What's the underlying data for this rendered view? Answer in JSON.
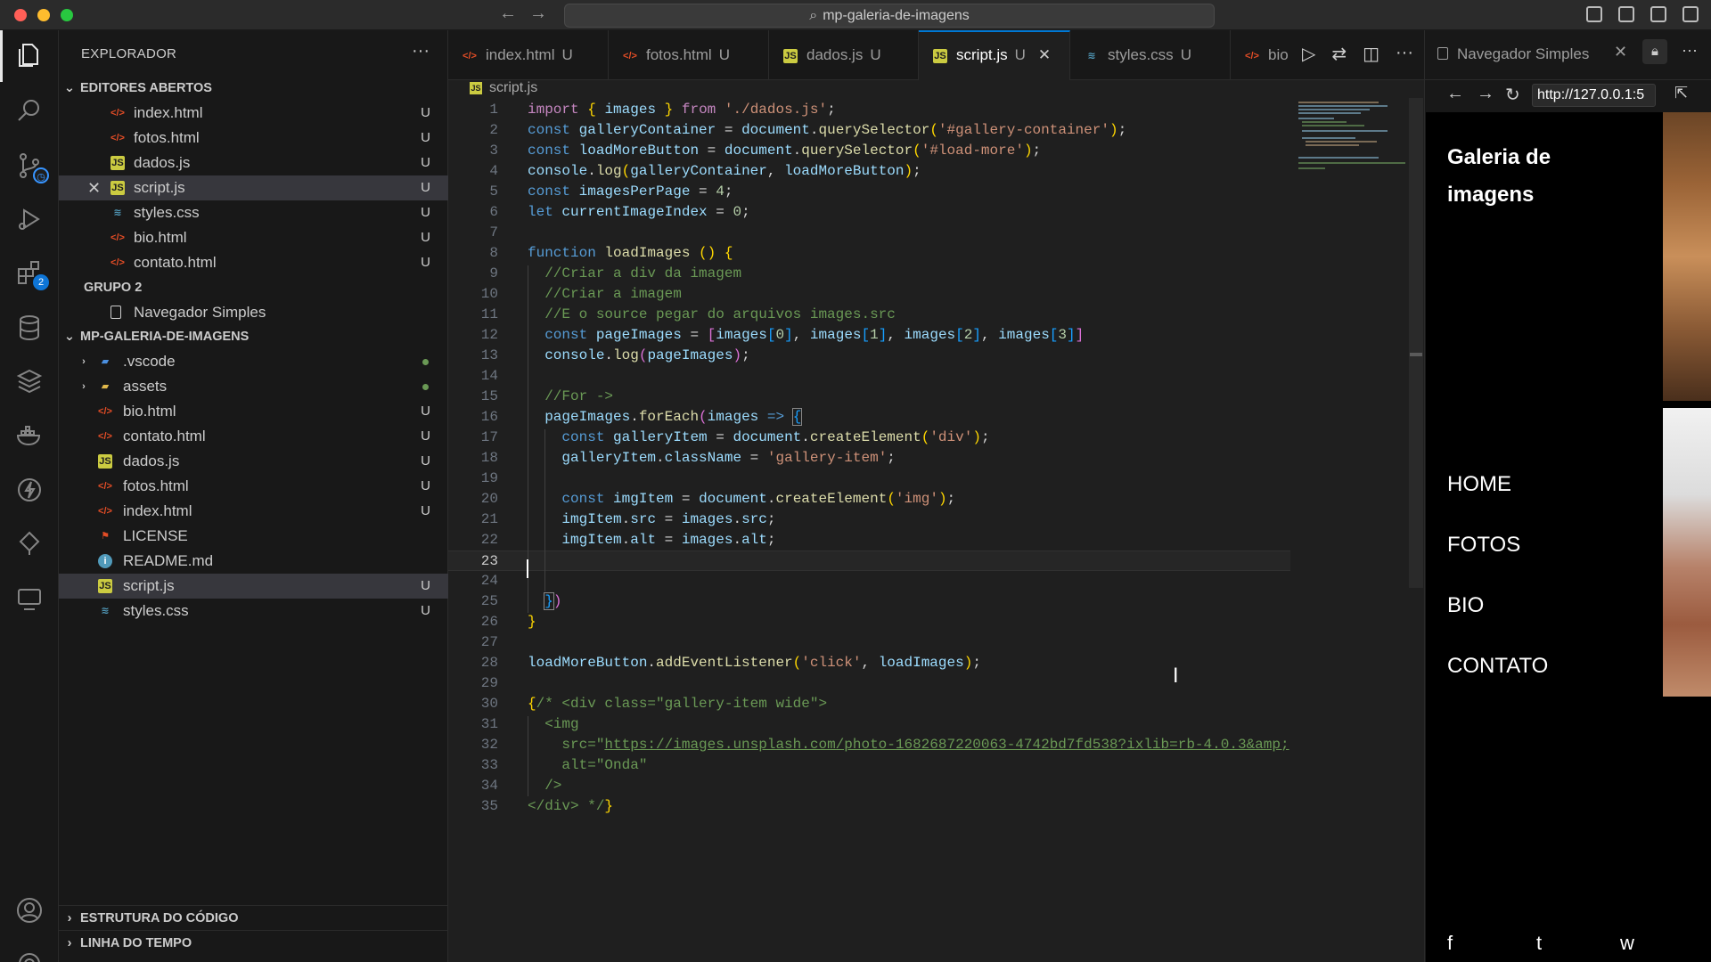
{
  "window": {
    "command_center": "mp-galeria-de-imagens"
  },
  "explorer": {
    "title": "EXPLORADOR",
    "open_editors_title": "EDITORES ABERTOS",
    "open_editors": [
      {
        "name": "index.html",
        "status": "U"
      },
      {
        "name": "fotos.html",
        "status": "U"
      },
      {
        "name": "dados.js",
        "status": "U"
      },
      {
        "name": "script.js",
        "status": "U"
      },
      {
        "name": "styles.css",
        "status": "U"
      },
      {
        "name": "bio.html",
        "status": "U"
      },
      {
        "name": "contato.html",
        "status": "U"
      }
    ],
    "group2_title": "GRUPO 2",
    "group2_item": "Navegador Simples",
    "project_title": "MP-GALERIA-DE-IMAGENS",
    "project_items": [
      {
        "name": ".vscode",
        "status": ""
      },
      {
        "name": "assets",
        "status": ""
      },
      {
        "name": "bio.html",
        "status": "U"
      },
      {
        "name": "contato.html",
        "status": "U"
      },
      {
        "name": "dados.js",
        "status": "U"
      },
      {
        "name": "fotos.html",
        "status": "U"
      },
      {
        "name": "index.html",
        "status": "U"
      },
      {
        "name": "LICENSE",
        "status": ""
      },
      {
        "name": "README.md",
        "status": ""
      },
      {
        "name": "script.js",
        "status": "U"
      },
      {
        "name": "styles.css",
        "status": "U"
      }
    ],
    "outline_title": "ESTRUTURA DO CÓDIGO",
    "timeline_title": "LINHA DO TEMPO"
  },
  "activity_bar": {
    "extensions_badge": "2"
  },
  "tabs": [
    {
      "name": "index.html",
      "status": "U"
    },
    {
      "name": "fotos.html",
      "status": "U"
    },
    {
      "name": "dados.js",
      "status": "U"
    },
    {
      "name": "script.js",
      "status": "U"
    },
    {
      "name": "styles.css",
      "status": "U"
    },
    {
      "name": "bio",
      "status": ""
    }
  ],
  "breadcrumb": "script.js",
  "editor": {
    "line_numbers": [
      "1",
      "2",
      "3",
      "4",
      "5",
      "6",
      "7",
      "8",
      "9",
      "10",
      "11",
      "12",
      "13",
      "14",
      "15",
      "16",
      "17",
      "18",
      "19",
      "20",
      "21",
      "22",
      "23",
      "24",
      "25",
      "26",
      "27",
      "28",
      "29",
      "30",
      "31",
      "32",
      "33",
      "34",
      "35"
    ],
    "current_line": "23"
  },
  "browser": {
    "tab_title": "Navegador Simples",
    "url": "http://127.0.0.1:5",
    "site_title": "Galeria de imagens",
    "nav": [
      "HOME",
      "FOTOS",
      "BIO",
      "CONTATO"
    ],
    "social": [
      "f",
      "t",
      "w"
    ]
  }
}
